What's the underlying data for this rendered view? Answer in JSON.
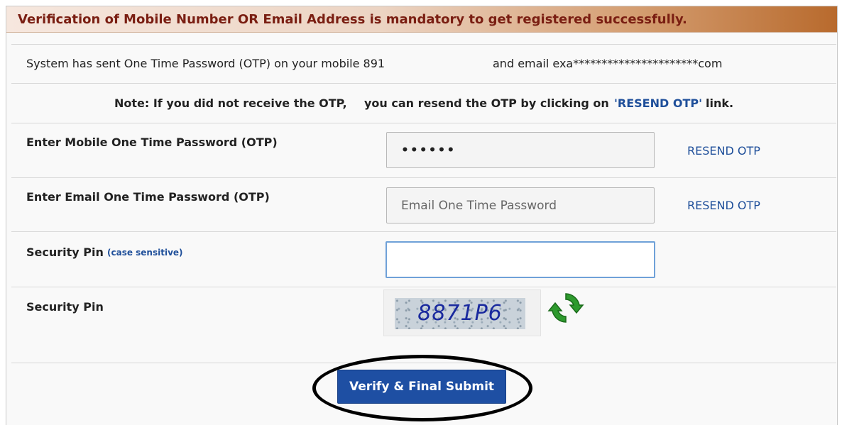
{
  "header": {
    "text": "Verification of Mobile Number OR Email Address is mandatory to get registered successfully."
  },
  "info": {
    "mobile_text": "System has sent One Time Password (OTP) on your mobile 891",
    "email_text": "and email exa**********************com"
  },
  "note": {
    "prefix": "Note: If you did not receive the OTP,",
    "middle": "you can resend the OTP by clicking on",
    "link": "'RESEND OTP'",
    "suffix": "link."
  },
  "mobile_otp": {
    "label": "Enter Mobile One Time Password (OTP)",
    "value": "••••••",
    "resend": "RESEND OTP"
  },
  "email_otp": {
    "label": "Enter Email One Time Password (OTP)",
    "placeholder": "Email One Time Password",
    "resend": "RESEND OTP"
  },
  "security_pin_input": {
    "label": "Security Pin",
    "hint": "(case sensitive)",
    "value": ""
  },
  "security_pin_captcha": {
    "label": "Security Pin",
    "captcha_text": "8871P6",
    "refresh_icon": "refresh-icon"
  },
  "submit": {
    "label": "Verify & Final Submit"
  },
  "colors": {
    "header_text": "#7a1e12",
    "link": "#1f4f9a",
    "button": "#1e4fa3",
    "refresh_green": "#2e9a2e"
  }
}
